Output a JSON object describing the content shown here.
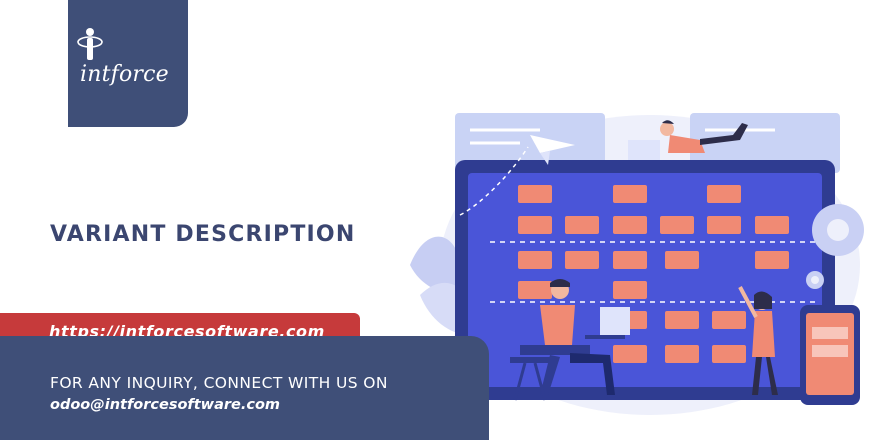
{
  "brand": {
    "logo_text": "intforce",
    "logo_bg": "#3f4f78",
    "accent_red": "#c63a3b",
    "headline_color": "#3b4670"
  },
  "headline": "VARIANT DESCRIPTION",
  "url_banner": {
    "text": "https://intforcesoftware.com"
  },
  "contact": {
    "line1": "FOR ANY INQUIRY, CONNECT WITH US ON",
    "email": "odoo@intforcesoftware.com"
  },
  "illustration": {
    "icons": [
      "kanban-board-illustration",
      "paper-plane-icon",
      "gear-icon",
      "tablet-icon"
    ]
  }
}
